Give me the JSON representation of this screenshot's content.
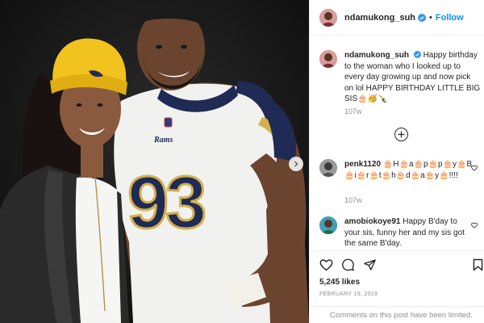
{
  "header": {
    "username": "ndamukong_suh",
    "separator": "•",
    "follow_label": "Follow"
  },
  "caption": {
    "username": "ndamukong_suh",
    "text": "Happy birthday to the woman who I looked up to every day growing up and now pick on lol HAPPY BIRTHDAY LITTLE BIG SIS🎂🥳🍾",
    "time": "107w"
  },
  "comments": [
    {
      "username": "penk1120",
      "text": "🎂H🎂a🎂p🎂p🎂y🎂B🎂i🎂r🎂t🎂h🎂d🎂a🎂y🎂!!!!",
      "time": "107w"
    },
    {
      "username": "amobiokoye91",
      "text": "Happy B'day to your sis, funny her and my sis got the same B'day."
    }
  ],
  "jersey_number": "93",
  "jersey_brand": "Rams",
  "likes": "5,245 likes",
  "date": "FEBRUARY 19, 2019",
  "comments_notice": "Comments on this post have been limited.",
  "icons": {
    "like": "heart-icon",
    "comment": "comment-icon",
    "share": "share-icon",
    "save": "bookmark-icon",
    "load_more": "plus-circle-icon"
  },
  "colors": {
    "follow": "#0095f6",
    "text": "#262626",
    "muted": "#8e8e8e",
    "verified": "#3897f0",
    "beanie": "#f2c21f",
    "jersey_navy": "#1f2a55"
  }
}
